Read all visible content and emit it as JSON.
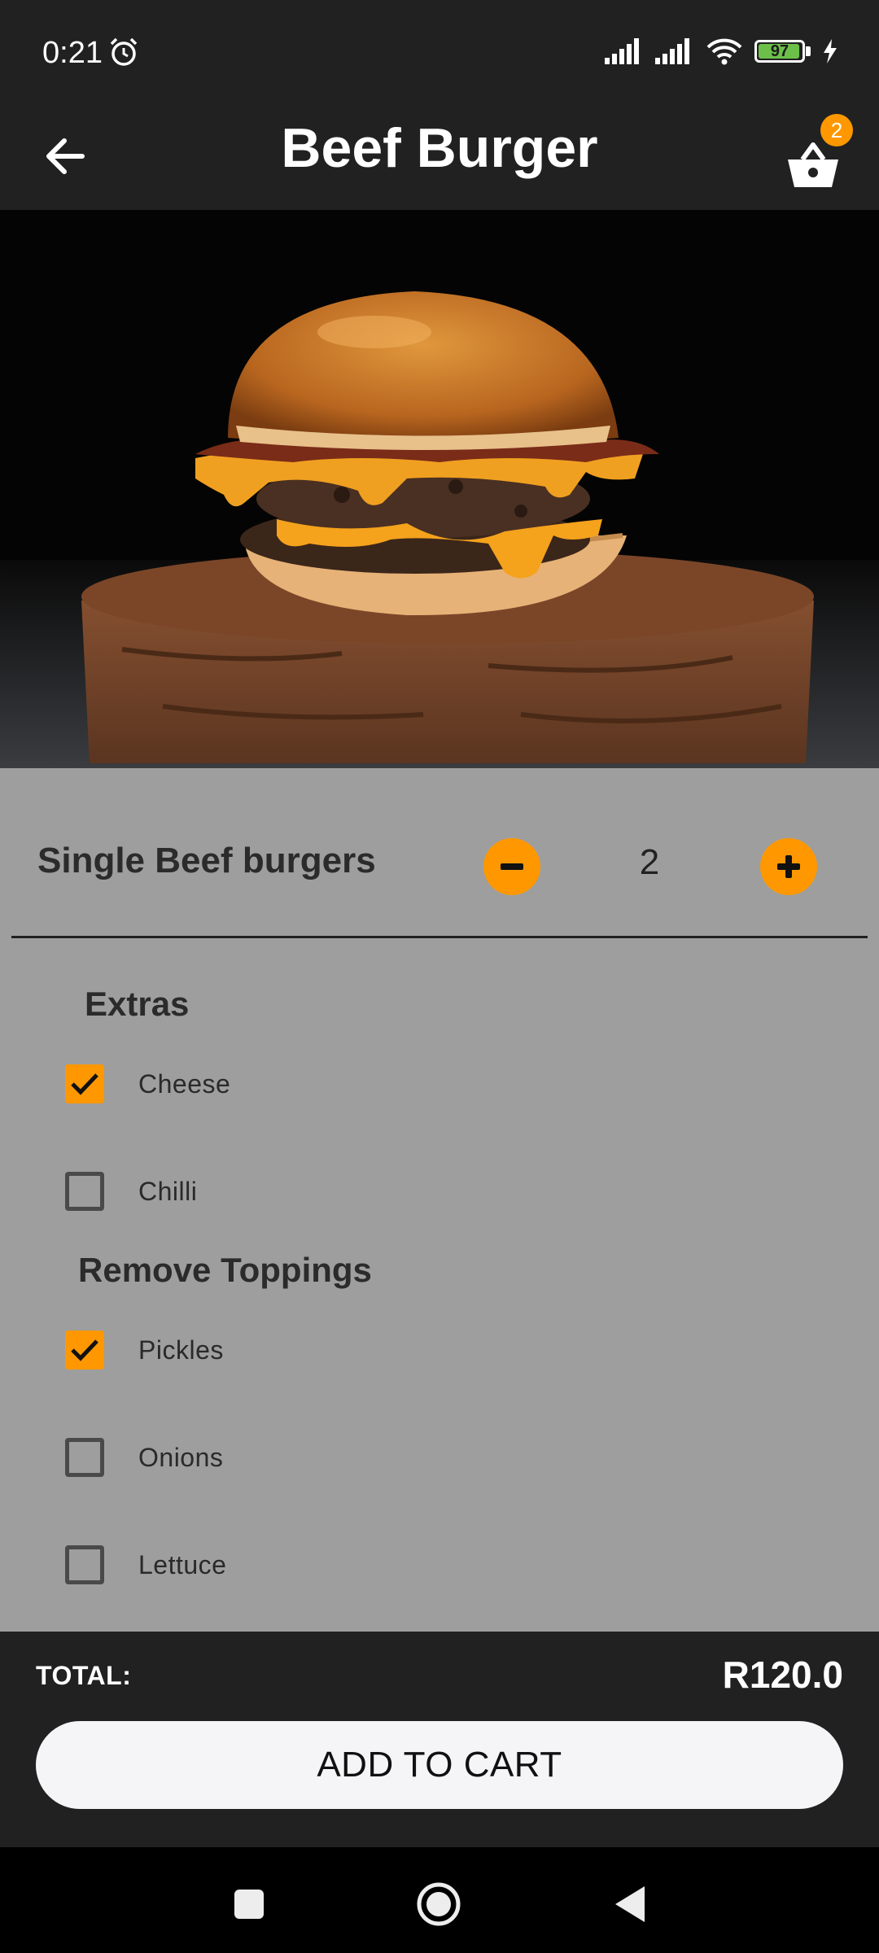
{
  "status": {
    "time": "0:21",
    "battery": "97"
  },
  "appbar": {
    "title": "Beef Burger",
    "cart_count": "2"
  },
  "product": {
    "name": "Single Beef burgers",
    "quantity": "2"
  },
  "extras": {
    "title": "Extras",
    "items": [
      {
        "label": "Cheese",
        "checked": true
      },
      {
        "label": "Chilli",
        "checked": false
      }
    ]
  },
  "remove": {
    "title": "Remove Toppings",
    "items": [
      {
        "label": "Pickles",
        "checked": true
      },
      {
        "label": "Onions",
        "checked": false
      },
      {
        "label": "Lettuce",
        "checked": false
      }
    ]
  },
  "footer": {
    "total_label": "TOTAL:",
    "total_value": "R120.0",
    "add_to_cart": "ADD TO CART"
  },
  "colors": {
    "accent": "#ff9800",
    "bar": "#212121",
    "background": "#9e9e9e"
  },
  "icons": [
    "alarm-icon",
    "signal-icon",
    "wifi-icon",
    "battery-icon",
    "charging-icon",
    "back-arrow-icon",
    "basket-icon",
    "minus-icon",
    "plus-icon",
    "check-icon",
    "nav-recents-icon",
    "nav-home-icon",
    "nav-back-icon"
  ]
}
